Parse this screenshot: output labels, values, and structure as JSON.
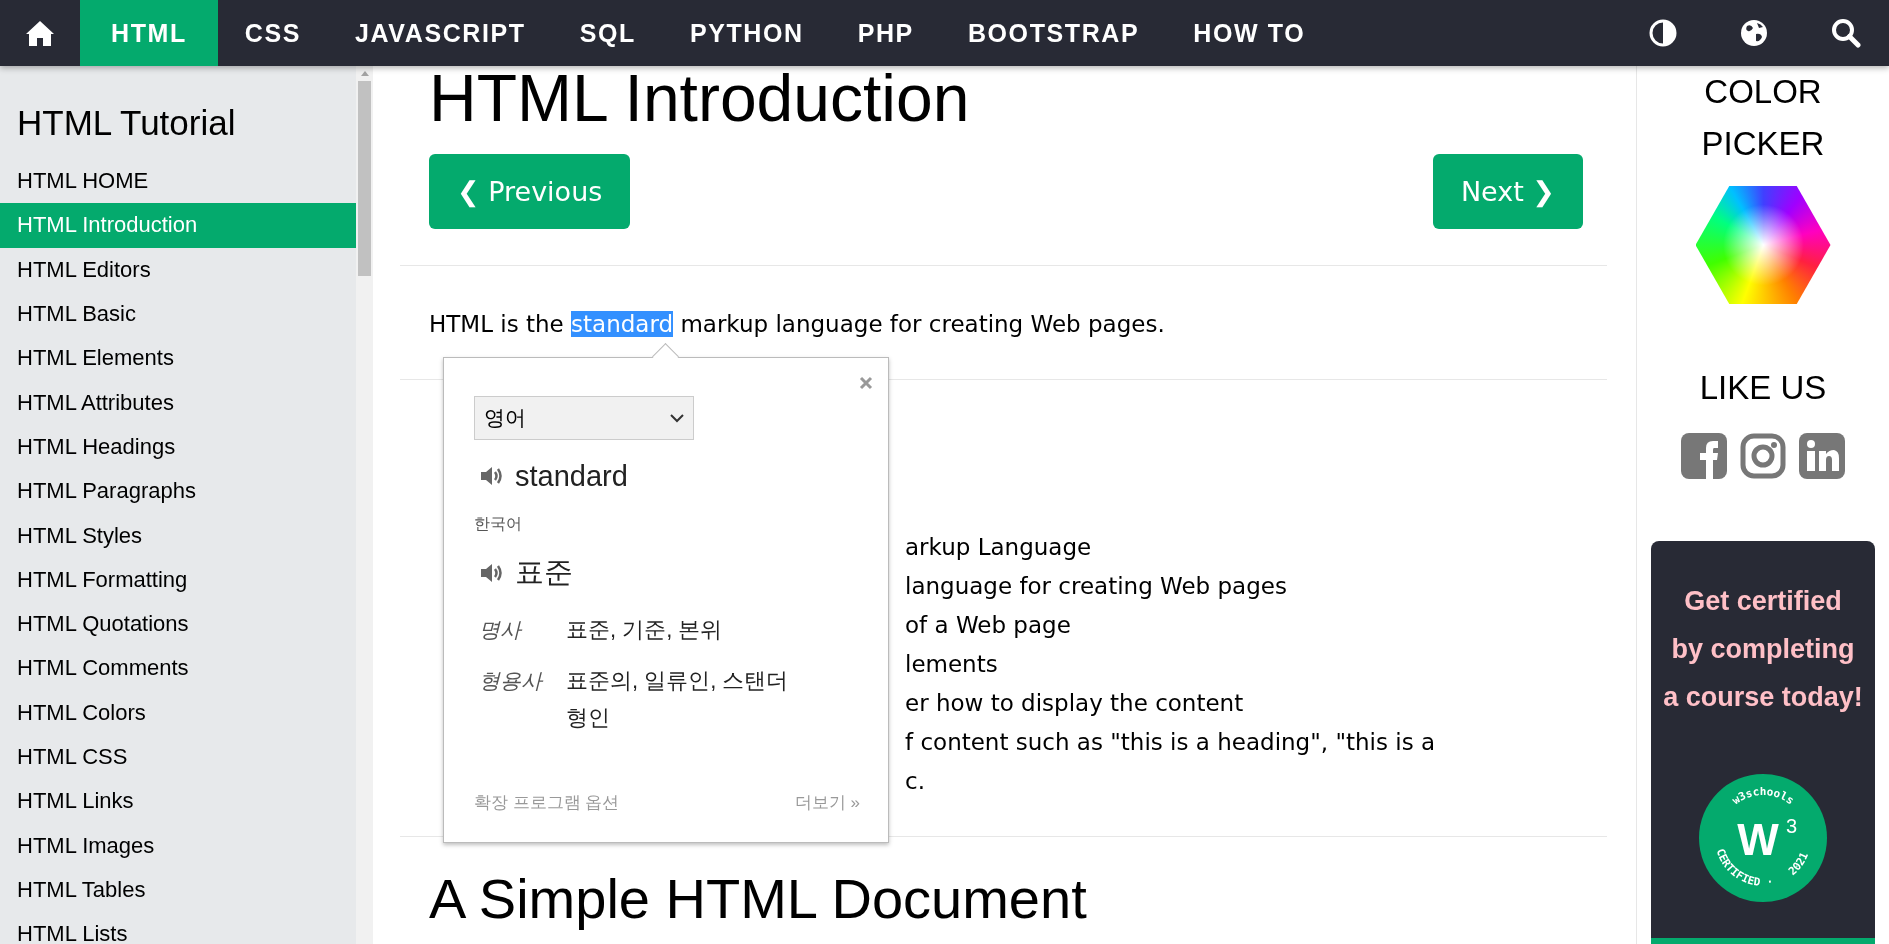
{
  "nav": {
    "items": [
      {
        "label": "HTML",
        "selected": true
      },
      {
        "label": "CSS",
        "selected": false
      },
      {
        "label": "JAVASCRIPT",
        "selected": false
      },
      {
        "label": "SQL",
        "selected": false
      },
      {
        "label": "PYTHON",
        "selected": false
      },
      {
        "label": "PHP",
        "selected": false
      },
      {
        "label": "BOOTSTRAP",
        "selected": false
      },
      {
        "label": "HOW TO",
        "selected": false
      }
    ]
  },
  "sidebar": {
    "title": "HTML Tutorial",
    "items": [
      {
        "label": "HTML HOME",
        "selected": false
      },
      {
        "label": "HTML Introduction",
        "selected": true
      },
      {
        "label": "HTML Editors",
        "selected": false
      },
      {
        "label": "HTML Basic",
        "selected": false
      },
      {
        "label": "HTML Elements",
        "selected": false
      },
      {
        "label": "HTML Attributes",
        "selected": false
      },
      {
        "label": "HTML Headings",
        "selected": false
      },
      {
        "label": "HTML Paragraphs",
        "selected": false
      },
      {
        "label": "HTML Styles",
        "selected": false
      },
      {
        "label": "HTML Formatting",
        "selected": false
      },
      {
        "label": "HTML Quotations",
        "selected": false
      },
      {
        "label": "HTML Comments",
        "selected": false
      },
      {
        "label": "HTML Colors",
        "selected": false
      },
      {
        "label": "HTML CSS",
        "selected": false
      },
      {
        "label": "HTML Links",
        "selected": false
      },
      {
        "label": "HTML Images",
        "selected": false
      },
      {
        "label": "HTML Tables",
        "selected": false
      },
      {
        "label": "HTML Lists",
        "selected": false
      }
    ]
  },
  "main": {
    "title": "HTML Introduction",
    "prev_button": "❮ Previous",
    "next_button": "Next ❯",
    "intro": {
      "before": "HTML is the ",
      "selected_text": "standard",
      "after": " markup language for creating Web pages."
    },
    "list_fragments": [
      "arkup Language",
      "language for creating Web pages",
      "of a Web page",
      "lements",
      "er how to display the content",
      "f content such as \"this is a heading\", \"this is a",
      "c."
    ],
    "next_heading": "A Simple HTML Document"
  },
  "translate_popup": {
    "source_language": "영어",
    "word": "standard",
    "target_language": "한국어",
    "translation": "표준",
    "definitions": [
      {
        "part": "명사",
        "meanings": "표준, 기준, 본위"
      },
      {
        "part": "형용사",
        "meanings": "표준의, 일류인, 스탠더형인"
      }
    ],
    "options_link": "확장 프로그램 옵션",
    "more_link": "더보기 »"
  },
  "right": {
    "color_picker_title": "COLOR PICKER",
    "like_title": "LIKE US",
    "cert_card": {
      "lines": [
        "Get certified",
        "by completing",
        "a course today!"
      ],
      "badge": {
        "logo": "W",
        "sup": "3",
        "arc_top": "w3schools",
        "arc_bottom": "CERTIFIED",
        "dot": "·",
        "year": "2021"
      }
    }
  }
}
